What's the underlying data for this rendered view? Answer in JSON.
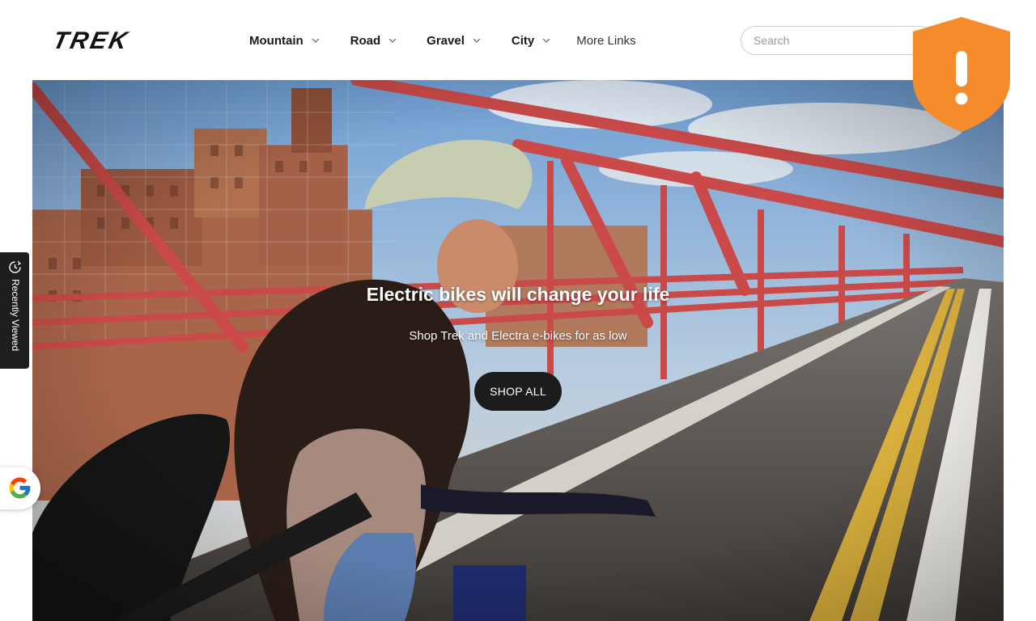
{
  "header": {
    "brand": "TREK",
    "nav": [
      {
        "label": "Mountain"
      },
      {
        "label": "Road"
      },
      {
        "label": "Gravel"
      },
      {
        "label": "City"
      }
    ],
    "more_links": "More Links",
    "search_placeholder": "Search"
  },
  "hero": {
    "title": "Electric bikes will change your life",
    "subtitle": "Shop Trek and Electra e-bikes for as low",
    "cta": "SHOP ALL"
  },
  "side_tab": {
    "label": "Recently Viewed"
  },
  "icons": {
    "shield": "shield-alert-icon",
    "recently_viewed": "recently-viewed-icon",
    "google": "google-icon",
    "chevron": "chevron-down-icon"
  },
  "colors": {
    "shield": "#f68b2c",
    "button": "#1c1c1c",
    "bridge": "#c94a48"
  }
}
